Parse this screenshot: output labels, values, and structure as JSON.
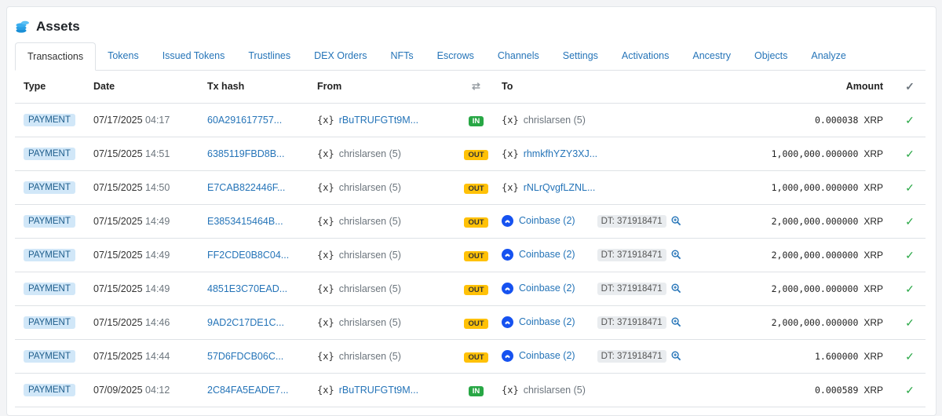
{
  "header": {
    "title": "Assets",
    "icon": "coins-stack-icon"
  },
  "tabs": [
    "Transactions",
    "Tokens",
    "Issued Tokens",
    "Trustlines",
    "DEX Orders",
    "NFTs",
    "Escrows",
    "Channels",
    "Settings",
    "Activations",
    "Ancestry",
    "Objects",
    "Analyze"
  ],
  "active_tab": 0,
  "columns": {
    "type": "Type",
    "date": "Date",
    "hash": "Tx hash",
    "from": "From",
    "swap": "⇄",
    "to": "To",
    "amount": "Amount",
    "status": "✓"
  },
  "rows": [
    {
      "type": "PAYMENT",
      "date": "07/17/2025",
      "time": "04:17",
      "hash": "60A291617757...",
      "from_icon": "{x}",
      "from": "rBuTRUFGTt9M...",
      "from_link": true,
      "dir": "IN",
      "to_kind": "plain",
      "to_icon": "{x}",
      "to": "chrislarsen (5)",
      "to_link": false,
      "dt": "",
      "amount": "0.000038",
      "currency": "XRP"
    },
    {
      "type": "PAYMENT",
      "date": "07/15/2025",
      "time": "14:51",
      "hash": "6385119FBD8B...",
      "from_icon": "{x}",
      "from": "chrislarsen (5)",
      "from_link": false,
      "dir": "OUT",
      "to_kind": "plain",
      "to_icon": "{x}",
      "to": "rhmkfhYZY3XJ...",
      "to_link": true,
      "dt": "",
      "amount": "1,000,000.000000",
      "currency": "XRP"
    },
    {
      "type": "PAYMENT",
      "date": "07/15/2025",
      "time": "14:50",
      "hash": "E7CAB822446F...",
      "from_icon": "{x}",
      "from": "chrislarsen (5)",
      "from_link": false,
      "dir": "OUT",
      "to_kind": "plain",
      "to_icon": "{x}",
      "to": "rNLrQvgfLZNL...",
      "to_link": true,
      "dt": "",
      "amount": "1,000,000.000000",
      "currency": "XRP"
    },
    {
      "type": "PAYMENT",
      "date": "07/15/2025",
      "time": "14:49",
      "hash": "E3853415464B...",
      "from_icon": "{x}",
      "from": "chrislarsen (5)",
      "from_link": false,
      "dir": "OUT",
      "to_kind": "coinbase",
      "to_icon": "coinbase-icon",
      "to": "Coinbase (2)",
      "to_link": true,
      "dt": "DT: 371918471",
      "amount": "2,000,000.000000",
      "currency": "XRP"
    },
    {
      "type": "PAYMENT",
      "date": "07/15/2025",
      "time": "14:49",
      "hash": "FF2CDE0B8C04...",
      "from_icon": "{x}",
      "from": "chrislarsen (5)",
      "from_link": false,
      "dir": "OUT",
      "to_kind": "coinbase",
      "to_icon": "coinbase-icon",
      "to": "Coinbase (2)",
      "to_link": true,
      "dt": "DT: 371918471",
      "amount": "2,000,000.000000",
      "currency": "XRP"
    },
    {
      "type": "PAYMENT",
      "date": "07/15/2025",
      "time": "14:49",
      "hash": "4851E3C70EAD...",
      "from_icon": "{x}",
      "from": "chrislarsen (5)",
      "from_link": false,
      "dir": "OUT",
      "to_kind": "coinbase",
      "to_icon": "coinbase-icon",
      "to": "Coinbase (2)",
      "to_link": true,
      "dt": "DT: 371918471",
      "amount": "2,000,000.000000",
      "currency": "XRP"
    },
    {
      "type": "PAYMENT",
      "date": "07/15/2025",
      "time": "14:46",
      "hash": "9AD2C17DE1C...",
      "from_icon": "{x}",
      "from": "chrislarsen (5)",
      "from_link": false,
      "dir": "OUT",
      "to_kind": "coinbase",
      "to_icon": "coinbase-icon",
      "to": "Coinbase (2)",
      "to_link": true,
      "dt": "DT: 371918471",
      "amount": "2,000,000.000000",
      "currency": "XRP"
    },
    {
      "type": "PAYMENT",
      "date": "07/15/2025",
      "time": "14:44",
      "hash": "57D6FDCB06C...",
      "from_icon": "{x}",
      "from": "chrislarsen (5)",
      "from_link": false,
      "dir": "OUT",
      "to_kind": "coinbase",
      "to_icon": "coinbase-icon",
      "to": "Coinbase (2)",
      "to_link": true,
      "dt": "DT: 371918471",
      "amount": "1.600000",
      "currency": "XRP"
    },
    {
      "type": "PAYMENT",
      "date": "07/09/2025",
      "time": "04:12",
      "hash": "2C84FA5EADE7...",
      "from_icon": "{x}",
      "from": "rBuTRUFGTt9M...",
      "from_link": true,
      "dir": "IN",
      "to_kind": "plain",
      "to_icon": "{x}",
      "to": "chrislarsen (5)",
      "to_link": false,
      "dt": "",
      "amount": "0.000589",
      "currency": "XRP"
    }
  ],
  "colors": {
    "link": "#2574b8",
    "in": "#28a745",
    "out": "#ffc107",
    "type_badge": "#d1e7f8",
    "check": "#28a745"
  }
}
